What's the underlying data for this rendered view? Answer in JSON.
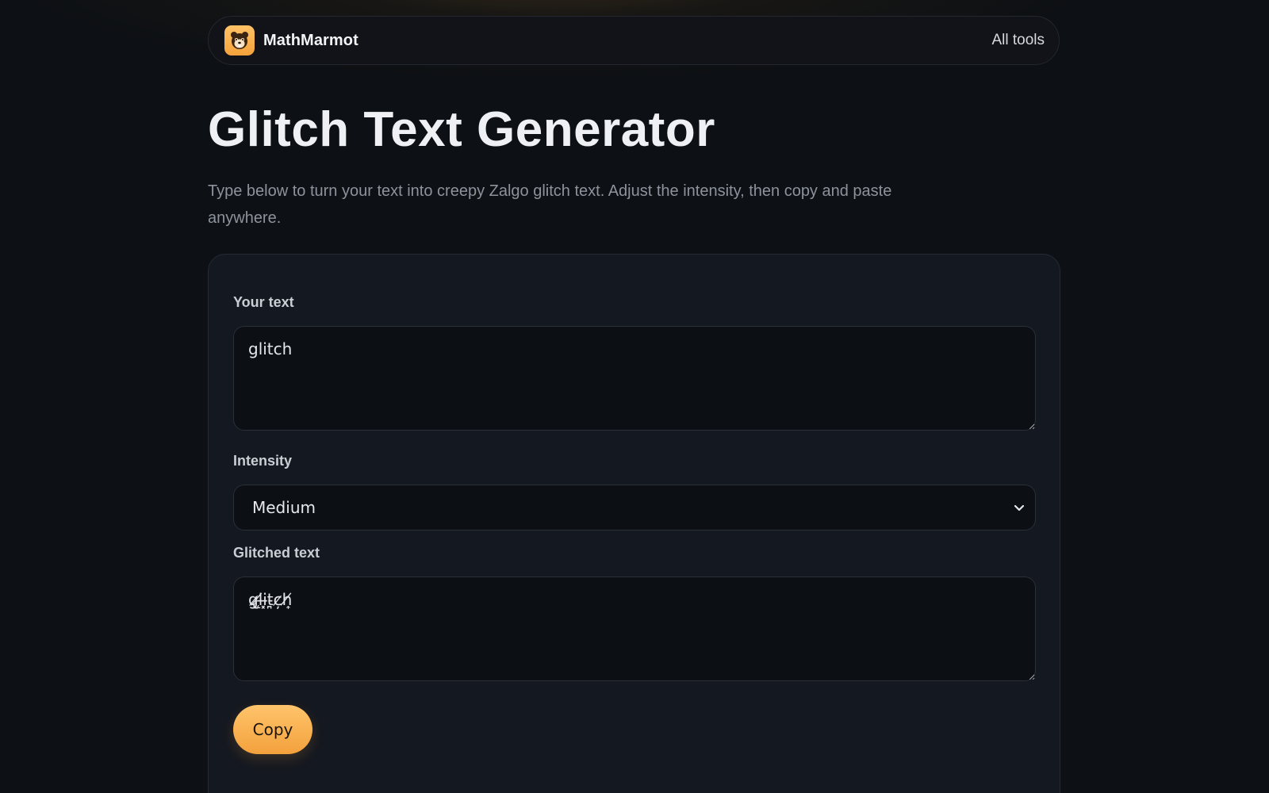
{
  "header": {
    "brand_name": "MathMarmot",
    "nav_link": "All tools",
    "brand_color": "#F5A23A"
  },
  "main": {
    "title": "Glitch Text Generator",
    "description": "Type below to turn your text into creepy Zalgo glitch text. Adjust the intensity, then copy and paste anywhere."
  },
  "form": {
    "input_label": "Your text",
    "input_value": "glitch",
    "intensity_label": "Intensity",
    "intensity_value": "Medium",
    "output_label": "Glitched text",
    "output_value": "g̷̢l̸̨i̶͓t̵̪c̷̦h̸͎",
    "copy_label": "Copy"
  }
}
